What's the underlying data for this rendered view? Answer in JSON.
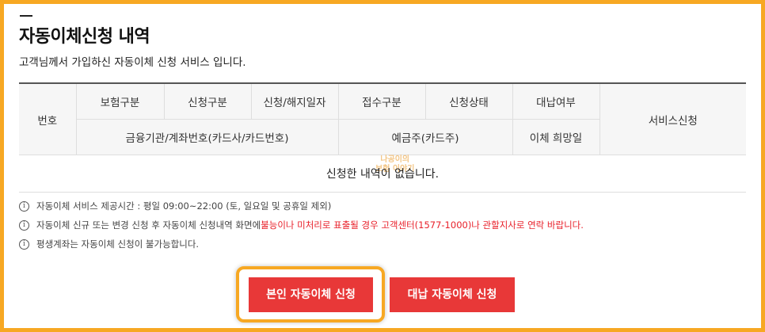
{
  "title": "자동이체신청 내역",
  "subtitle": "고객님께서 가입하신 자동이체 신청 서비스 입니다.",
  "table": {
    "no": "번호",
    "row1": [
      "보험구분",
      "신청구분",
      "신청/해지일자",
      "접수구분",
      "신청상태",
      "대납여부"
    ],
    "row2": [
      "금융기관/계좌번호(카드사/카드번호)",
      "예금주(카드주)",
      "이체 희망일"
    ],
    "service": "서비스신청",
    "empty": "신청한 내역이 없습니다."
  },
  "watermark": [
    "나공이의",
    "보험 이야기"
  ],
  "notes": {
    "n1": "자동이체 서비스 제공시간 : 평일 09:00~22:00 (토, 일요일 및 공휴일 제외)",
    "n2_pre": "자동이체 신규 또는 변경 신청 후 자동이체 신청내역 화면에 ",
    "n2_red": "불능이나 미처리로 표출될 경우 고객센터(1577-1000)나 관할지사로 연락 바랍니다.",
    "n3": "평생계좌는 자동이체 신청이 불가능합니다."
  },
  "buttons": {
    "self": "본인 자동이체 신청",
    "proxy": "대납 자동이체 신청"
  },
  "colors": {
    "accent_frame": "#f7a823",
    "button": "#e83838",
    "warning_text": "#e8202a"
  }
}
